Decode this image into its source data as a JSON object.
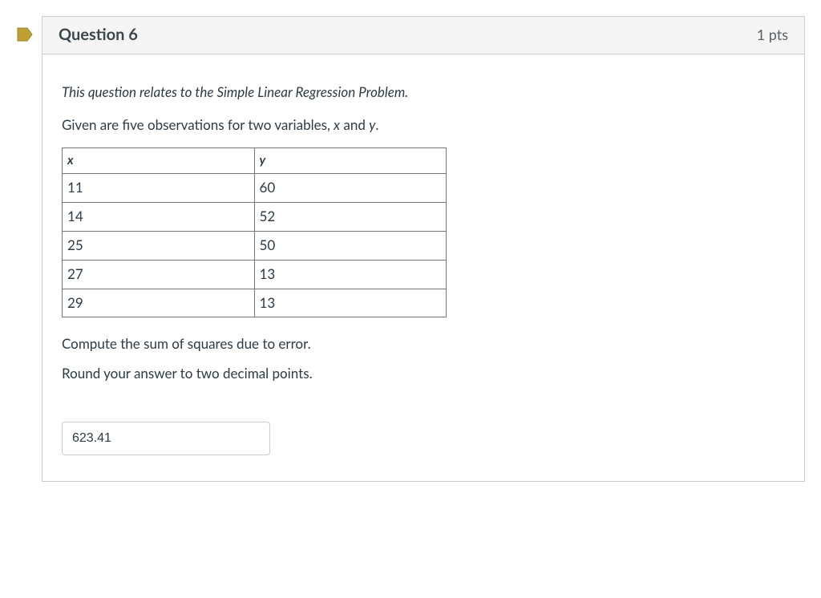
{
  "marker": {
    "present": true
  },
  "header": {
    "title": "Question 6",
    "points": "1 pts"
  },
  "body": {
    "intro_italic": "This question relates to the Simple Linear Regression Problem.",
    "given_prefix": "Given are five observations for two variables, ",
    "given_x": "x",
    "given_and": " and ",
    "given_y": "y",
    "given_suffix": ".",
    "compute_line": "Compute the sum of squares due to error.",
    "round_line": "Round your answer to two decimal points."
  },
  "table": {
    "headers": {
      "x": "x",
      "y": "y"
    },
    "rows": [
      {
        "x": "11",
        "y": "60"
      },
      {
        "x": "14",
        "y": "52"
      },
      {
        "x": "25",
        "y": "50"
      },
      {
        "x": "27",
        "y": "13"
      },
      {
        "x": "29",
        "y": "13"
      }
    ]
  },
  "answer": {
    "value": "623.41"
  },
  "chart_data": {
    "type": "table",
    "columns": [
      "x",
      "y"
    ],
    "rows": [
      [
        11,
        60
      ],
      [
        14,
        52
      ],
      [
        25,
        50
      ],
      [
        27,
        13
      ],
      [
        29,
        13
      ]
    ]
  }
}
